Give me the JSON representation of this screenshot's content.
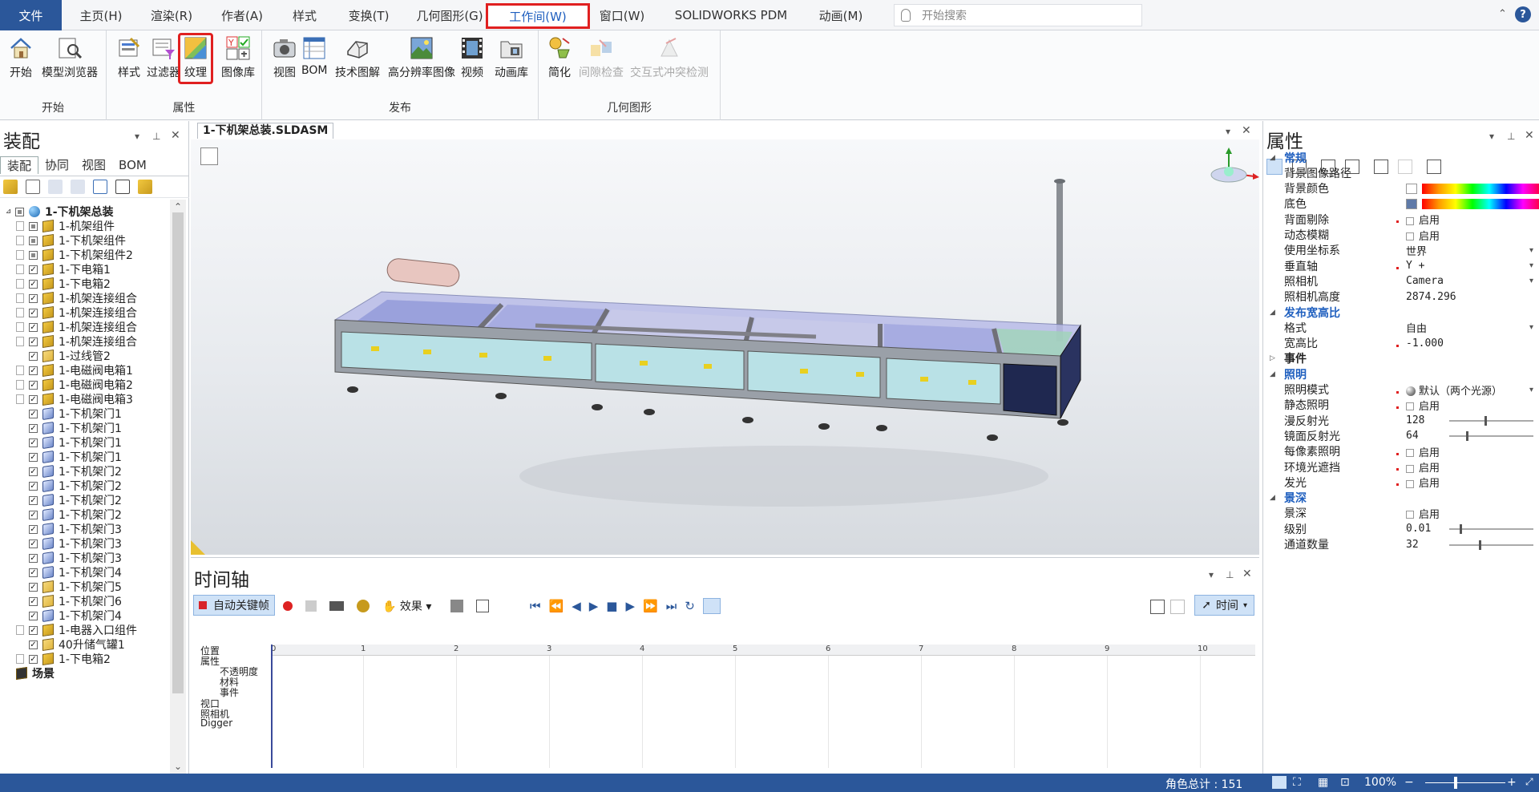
{
  "menu": {
    "file": "文件",
    "items": [
      "主页(H)",
      "渲染(R)",
      "作者(A)",
      "样式",
      "变换(T)",
      "几何图形(G)",
      "工作间(W)",
      "窗口(W)",
      "SOLIDWORKS PDM",
      "动画(M)"
    ],
    "search_placeholder": "开始搜索",
    "help": "?"
  },
  "ribbon": {
    "groups": [
      {
        "label": "开始",
        "buttons": [
          "开始",
          "模型浏览器"
        ]
      },
      {
        "label": "属性",
        "buttons": [
          "样式",
          "过滤器",
          "纹理",
          "图像库"
        ]
      },
      {
        "label": "发布",
        "buttons": [
          "视图",
          "BOM",
          "技术图解",
          "高分辨率图像",
          "视频",
          "动画库"
        ]
      },
      {
        "label": "几何图形",
        "buttons": [
          "简化",
          "间隙检查",
          "交互式冲突检测"
        ]
      }
    ]
  },
  "left_panel": {
    "title": "装配",
    "tabs": [
      "装配",
      "协同",
      "视图",
      "BOM"
    ],
    "tree": [
      {
        "label": "1-下机架总装",
        "bold": true,
        "icon": "globe"
      },
      {
        "label": "1-机架组件",
        "chk": "part"
      },
      {
        "label": "1-下机架组件",
        "chk": "part"
      },
      {
        "label": "1-下机架组件2",
        "chk": "part"
      },
      {
        "label": "1-下电箱1",
        "chk": "on"
      },
      {
        "label": "1-下电箱2",
        "chk": "on"
      },
      {
        "label": "1-机架连接组合",
        "chk": "on"
      },
      {
        "label": "1-机架连接组合",
        "chk": "on"
      },
      {
        "label": "1-机架连接组合",
        "chk": "on"
      },
      {
        "label": "1-机架连接组合",
        "chk": "on"
      },
      {
        "label": "1-过线管2",
        "chk": "on",
        "nolink": true,
        "icon": "part"
      },
      {
        "label": "1-电磁阀电箱1",
        "chk": "on"
      },
      {
        "label": "1-电磁阀电箱2",
        "chk": "on"
      },
      {
        "label": "1-电磁阀电箱3",
        "chk": "on"
      },
      {
        "label": "1-下机架门1",
        "chk": "on",
        "nolink": true,
        "icon": "door"
      },
      {
        "label": "1-下机架门1",
        "chk": "on",
        "nolink": true,
        "icon": "door"
      },
      {
        "label": "1-下机架门1",
        "chk": "on",
        "nolink": true,
        "icon": "door"
      },
      {
        "label": "1-下机架门1",
        "chk": "on",
        "nolink": true,
        "icon": "door"
      },
      {
        "label": "1-下机架门2",
        "chk": "on",
        "nolink": true,
        "icon": "door"
      },
      {
        "label": "1-下机架门2",
        "chk": "on",
        "nolink": true,
        "icon": "door"
      },
      {
        "label": "1-下机架门2",
        "chk": "on",
        "nolink": true,
        "icon": "door"
      },
      {
        "label": "1-下机架门2",
        "chk": "on",
        "nolink": true,
        "icon": "door"
      },
      {
        "label": "1-下机架门3",
        "chk": "on",
        "nolink": true,
        "icon": "door"
      },
      {
        "label": "1-下机架门3",
        "chk": "on",
        "nolink": true,
        "icon": "door"
      },
      {
        "label": "1-下机架门3",
        "chk": "on",
        "nolink": true,
        "icon": "door"
      },
      {
        "label": "1-下机架门4",
        "chk": "on",
        "nolink": true,
        "icon": "door"
      },
      {
        "label": "1-下机架门5",
        "chk": "on",
        "nolink": true,
        "icon": "part"
      },
      {
        "label": "1-下机架门6",
        "chk": "on",
        "nolink": true,
        "icon": "part"
      },
      {
        "label": "1-下机架门4",
        "chk": "on",
        "nolink": true,
        "icon": "door"
      },
      {
        "label": "1-电器入口组件",
        "chk": "on"
      },
      {
        "label": "40升储气罐1",
        "chk": "on",
        "nolink": true,
        "icon": "part"
      },
      {
        "label": "1-下电箱2",
        "chk": "on"
      },
      {
        "label": "场景",
        "bold": true,
        "icon": "scene"
      }
    ]
  },
  "document_tab": "1-下机架总装.SLDASM",
  "timeline": {
    "title": "时间轴",
    "auto_key": "自动关键帧",
    "effects": "效果",
    "time_mode": "时间",
    "ruler": [
      "0",
      "1",
      "2",
      "3",
      "4",
      "5",
      "6",
      "7",
      "8",
      "9",
      "10"
    ],
    "tracks": [
      "位置",
      "属性",
      "不透明度",
      "材料",
      "事件",
      "视口",
      "照相机",
      "Digger"
    ]
  },
  "properties": {
    "title": "属性",
    "rows": [
      {
        "type": "cat",
        "name": "常规",
        "open": true
      },
      {
        "name": "背景图像路径",
        "value": ""
      },
      {
        "name": "背景颜色",
        "value": "",
        "color": "#ffffff",
        "bar": true
      },
      {
        "name": "底色",
        "value": "",
        "color": "#5f7aa8",
        "bar": true
      },
      {
        "name": "背面剔除",
        "value": "启用",
        "check": true,
        "dot": true
      },
      {
        "name": "动态模糊",
        "value": "启用",
        "check": true
      },
      {
        "name": "使用坐标系",
        "value": "世界",
        "dd": true
      },
      {
        "name": "垂直轴",
        "value": "Y +",
        "dd": true,
        "dot": true
      },
      {
        "name": "照相机",
        "value": "Camera",
        "dd": true
      },
      {
        "name": "照相机高度",
        "value": "2874.296"
      },
      {
        "type": "cat",
        "name": "发布宽高比",
        "open": true
      },
      {
        "name": "格式",
        "value": "自由",
        "dd": true
      },
      {
        "name": "宽高比",
        "value": "-1.000",
        "dot": true
      },
      {
        "type": "cat",
        "name": "事件",
        "open": false,
        "plain": true
      },
      {
        "type": "cat",
        "name": "照明",
        "open": true
      },
      {
        "name": "照明模式",
        "value": "默认（两个光源）",
        "dd": true,
        "dot": true,
        "sphere": true
      },
      {
        "name": "静态照明",
        "value": "启用",
        "check": true,
        "dot": true
      },
      {
        "name": "漫反射光",
        "value": "128",
        "slider": 0.42
      },
      {
        "name": "镜面反射光",
        "value": "64",
        "slider": 0.2
      },
      {
        "name": "每像素照明",
        "value": "启用",
        "check": true,
        "dot": true
      },
      {
        "name": "环境光遮挡",
        "value": "启用",
        "check": true,
        "dot": true
      },
      {
        "name": "发光",
        "value": "启用",
        "check": true,
        "dot": true
      },
      {
        "type": "cat",
        "name": "景深",
        "open": true
      },
      {
        "name": "景深",
        "value": "启用",
        "check": true
      },
      {
        "name": "级别",
        "value": "0.01",
        "slider": 0.12
      },
      {
        "name": "通道数量",
        "value": "32",
        "slider": 0.35
      }
    ]
  },
  "status": {
    "actor_count": "角色总计 : 151",
    "zoom": "100%"
  },
  "colors": {
    "accent": "#2b579a",
    "highlight_red": "#e02020",
    "cat_blue": "#1f5fbf"
  }
}
